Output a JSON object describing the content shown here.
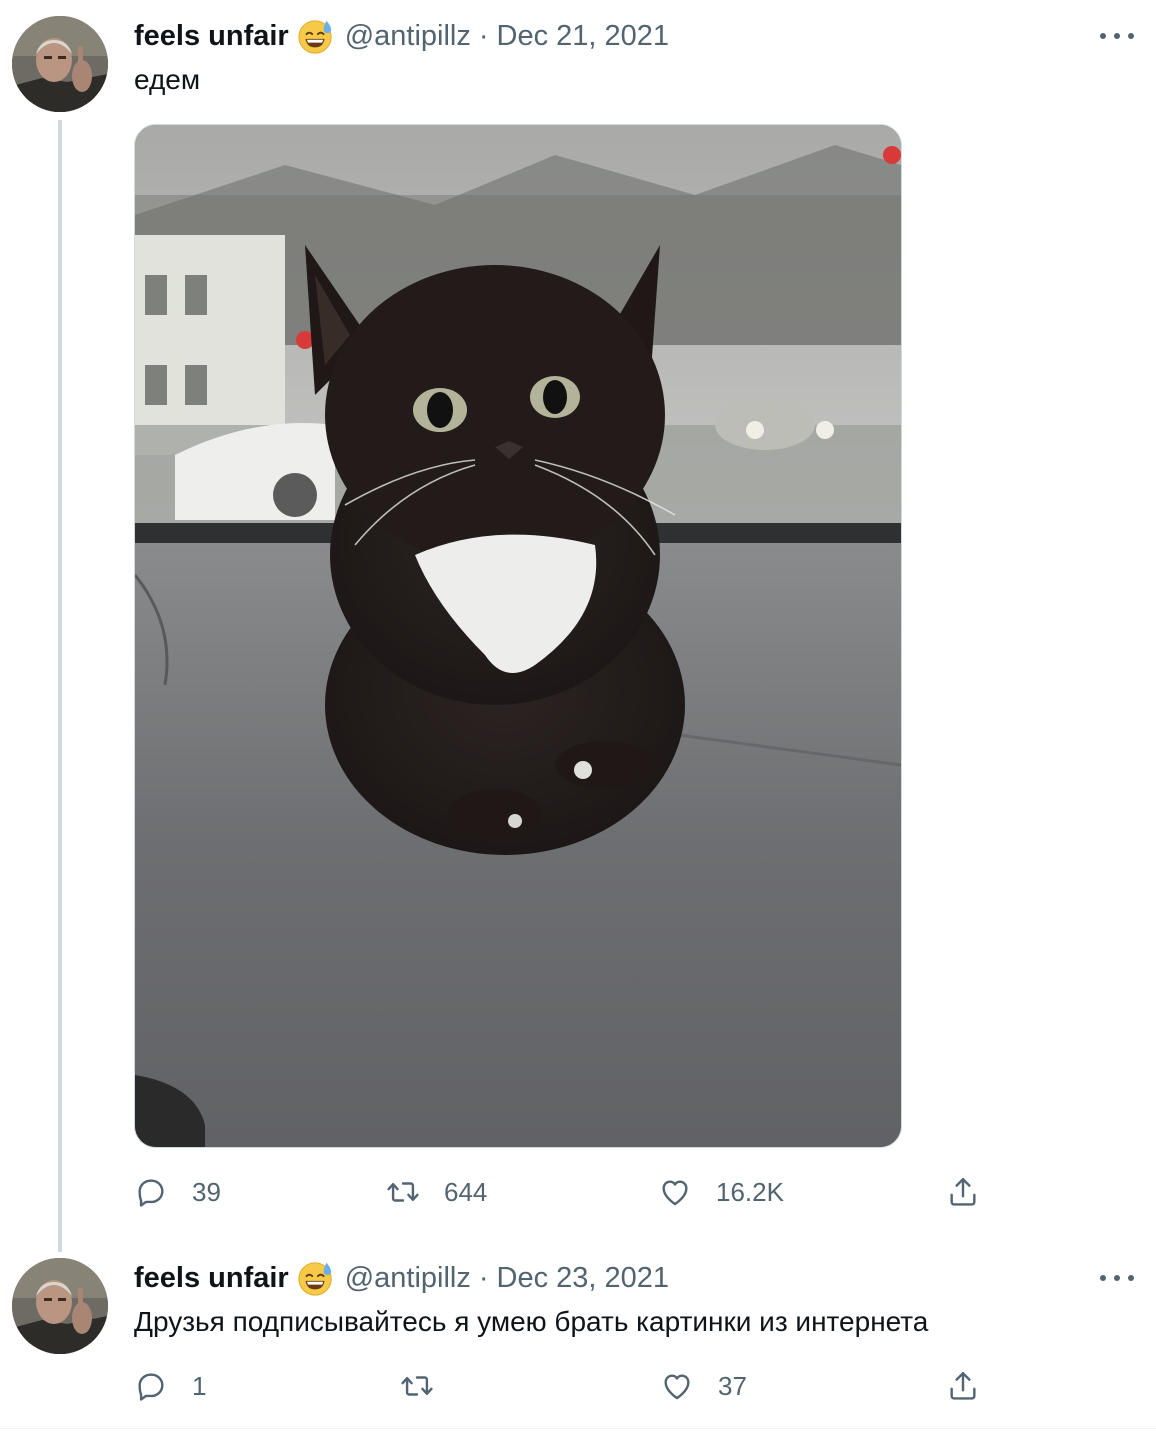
{
  "tweets": [
    {
      "author_name": "feels unfair",
      "handle": "@antipillz",
      "separator": "·",
      "date": "Dec 21, 2021",
      "text": "едем",
      "replies": "39",
      "retweets": "644",
      "likes": "16.2K",
      "has_media": true
    },
    {
      "author_name": "feels unfair",
      "handle": "@antipillz",
      "separator": "·",
      "date": "Dec 23, 2021",
      "text": "Друзья подписывайтесь я умею брать картинки из интернета",
      "replies": "1",
      "retweets": "",
      "likes": "37",
      "has_media": false
    }
  ],
  "icons": {
    "name_emoji": "grinning-sweat-emoji",
    "more": "more-horizontal-icon",
    "reply": "reply-icon",
    "retweet": "retweet-icon",
    "like": "heart-icon",
    "share": "share-icon"
  },
  "colors": {
    "text_primary": "#0f1419",
    "text_secondary": "#536471",
    "thread_line": "#cfd9de"
  }
}
